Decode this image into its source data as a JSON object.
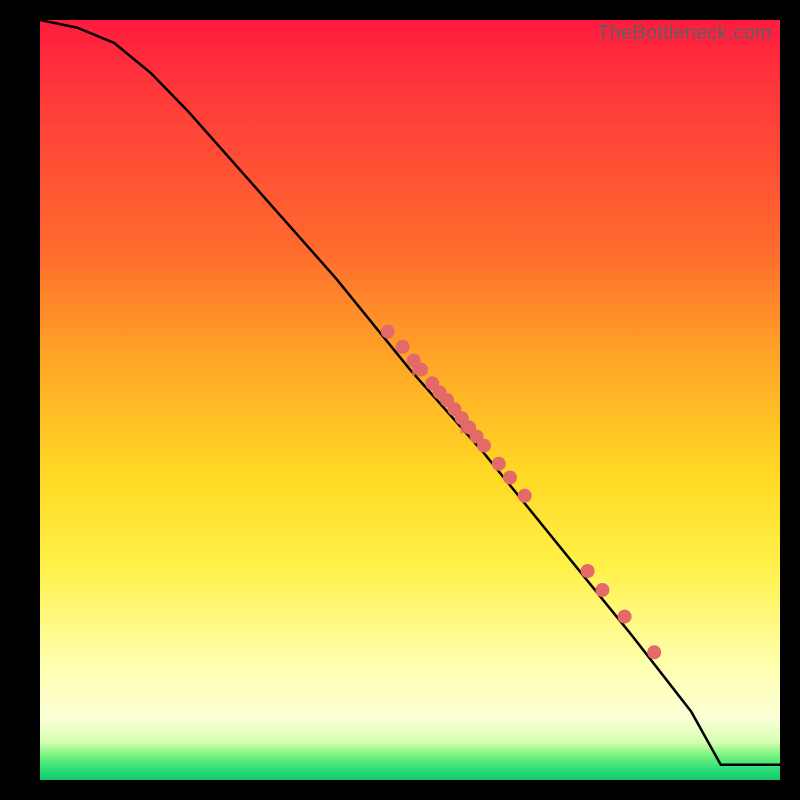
{
  "watermark": "TheBottleneck.com",
  "chart_data": {
    "type": "line",
    "title": "",
    "xlabel": "",
    "ylabel": "",
    "xlim": [
      0,
      100
    ],
    "ylim": [
      0,
      100
    ],
    "grid": false,
    "legend": false,
    "series": [
      {
        "name": "curve",
        "x": [
          0,
          5,
          10,
          15,
          20,
          30,
          40,
          50,
          60,
          70,
          80,
          88,
          92,
          100
        ],
        "y": [
          100,
          99,
          97,
          93,
          88,
          77,
          66,
          54,
          43,
          31,
          19,
          9,
          2,
          2
        ]
      }
    ],
    "scatter": [
      {
        "name": "cluster",
        "color": "#e46a6a",
        "points": [
          {
            "x": 47,
            "y": 59
          },
          {
            "x": 49,
            "y": 57
          },
          {
            "x": 50.5,
            "y": 55.2
          },
          {
            "x": 51.5,
            "y": 54
          },
          {
            "x": 53,
            "y": 52.2
          },
          {
            "x": 54,
            "y": 51
          },
          {
            "x": 55,
            "y": 50
          },
          {
            "x": 56,
            "y": 48.8
          },
          {
            "x": 57,
            "y": 47.6
          },
          {
            "x": 58,
            "y": 46.4
          },
          {
            "x": 59,
            "y": 45.2
          },
          {
            "x": 60,
            "y": 44
          },
          {
            "x": 62,
            "y": 41.6
          },
          {
            "x": 63.5,
            "y": 39.8
          },
          {
            "x": 65.5,
            "y": 37.4
          },
          {
            "x": 74,
            "y": 27.5
          },
          {
            "x": 76,
            "y": 25
          },
          {
            "x": 79,
            "y": 21.5
          },
          {
            "x": 83,
            "y": 16.8
          }
        ]
      }
    ]
  },
  "colors": {
    "background": "#000000",
    "gradient_top": "#ff1b3f",
    "gradient_bottom": "#18c76e",
    "curve": "#000000",
    "points": "#e46a6a",
    "watermark": "#5e5e5e"
  }
}
